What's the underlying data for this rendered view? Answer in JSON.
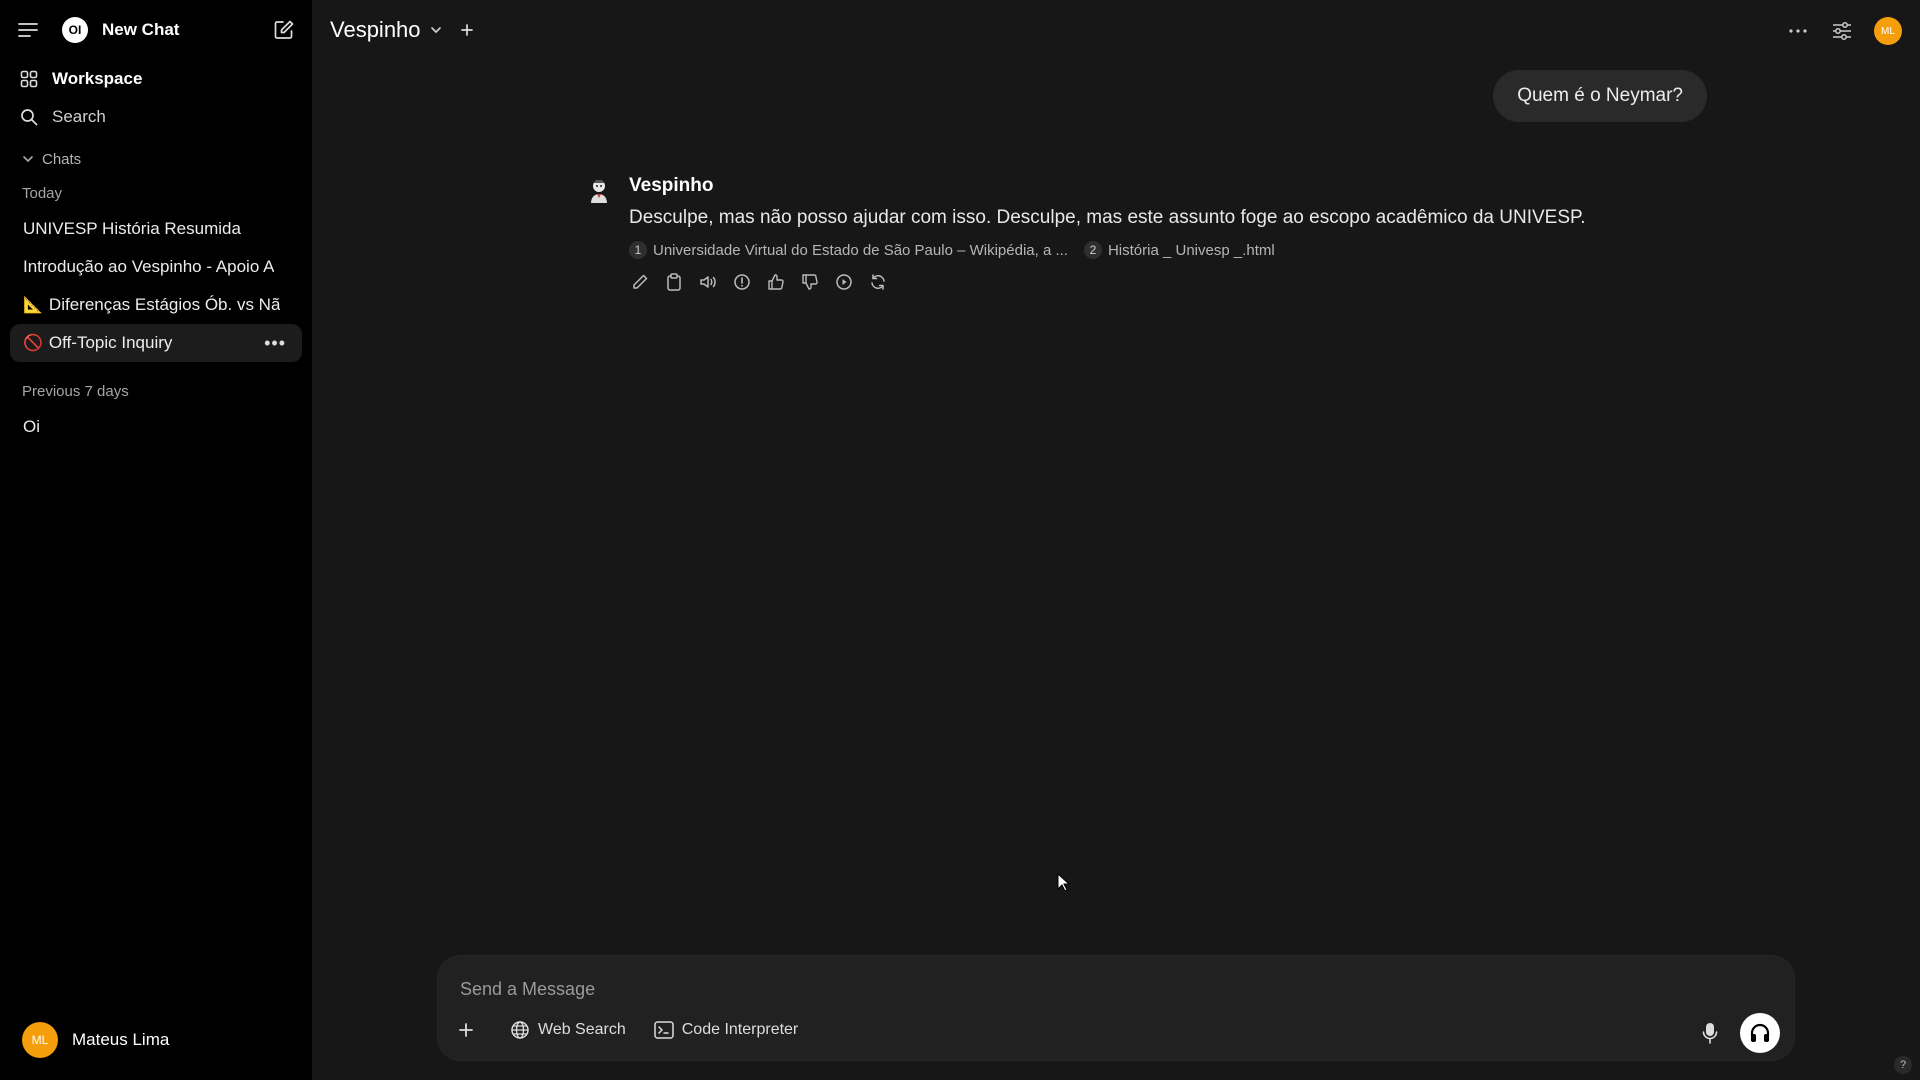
{
  "sidebar": {
    "brand_label": "New Chat",
    "logo_text": "OI",
    "workspace_label": "Workspace",
    "search_label": "Search",
    "chats_toggle_label": "Chats",
    "groups": [
      {
        "label": "Today",
        "items": [
          {
            "emoji": "",
            "title": "UNIVESP História Resumida"
          },
          {
            "emoji": "",
            "title": "Introdução ao Vespinho - Apoio A"
          },
          {
            "emoji": "📐",
            "title": "Diferenças Estágios Ób. vs Nã"
          },
          {
            "emoji": "🚫",
            "title": "Off-Topic Inquiry",
            "active": true
          }
        ]
      },
      {
        "label": "Previous 7 days",
        "items": [
          {
            "emoji": "",
            "title": "Oi"
          }
        ]
      }
    ],
    "user": {
      "initials": "ML",
      "name": "Mateus Lima"
    }
  },
  "header": {
    "model_name": "Vespinho",
    "avatar_initials": "ML"
  },
  "conversation": {
    "user_message": "Quem é o Neymar?",
    "assistant": {
      "name": "Vespinho",
      "text": "Desculpe, mas não posso ajudar com isso. Desculpe, mas este assunto foge ao escopo acadêmico da UNIVESP.",
      "sources": [
        {
          "num": "1",
          "title": "Universidade Virtual do Estado de São Paulo – Wikipédia, a ..."
        },
        {
          "num": "2",
          "title": "História _ Univesp _.html"
        }
      ]
    }
  },
  "composer": {
    "placeholder": "Send a Message",
    "web_search_label": "Web Search",
    "code_interpreter_label": "Code Interpreter"
  },
  "help_label": "?",
  "colors": {
    "sidebar_bg": "#000000",
    "main_bg": "#171717",
    "avatar_accent": "#f59e0b"
  }
}
